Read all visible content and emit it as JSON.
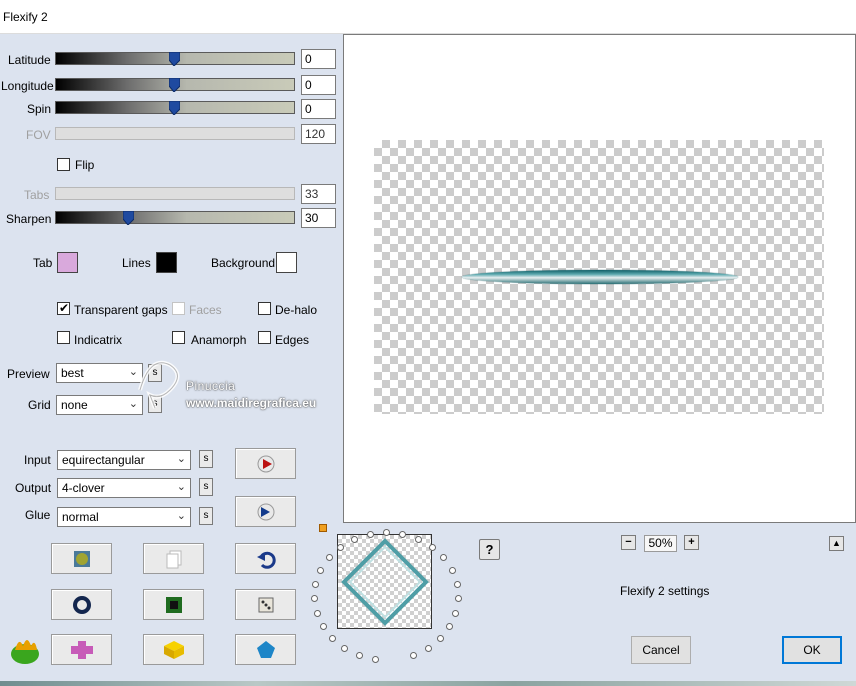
{
  "window": {
    "title": "Flexify 2"
  },
  "sliders": {
    "latitude": {
      "label": "Latitude",
      "value": "0"
    },
    "longitude": {
      "label": "Longitude",
      "value": "0"
    },
    "spin": {
      "label": "Spin",
      "value": "0"
    },
    "fov": {
      "label": "FOV",
      "value": "120"
    },
    "tabs": {
      "label": "Tabs",
      "value": "33"
    },
    "sharpen": {
      "label": "Sharpen",
      "value": "30"
    }
  },
  "flip": {
    "label": "Flip"
  },
  "colors": {
    "tab_label": "Tab",
    "tab_color": "#d9a9dc",
    "lines_label": "Lines",
    "lines_color": "#000000",
    "background_label": "Background",
    "background_color": "#ffffff"
  },
  "options": {
    "transparent_gaps": "Transparent gaps",
    "faces": "Faces",
    "de_halo": "De-halo",
    "indicatrix": "Indicatrix",
    "anamorph": "Anamorph",
    "edges": "Edges"
  },
  "preview": {
    "label": "Preview",
    "value": "best"
  },
  "grid": {
    "label": "Grid",
    "value": "none"
  },
  "projection": {
    "input_label": "Input",
    "input_value": "equirectangular",
    "output_label": "Output",
    "output_value": "4-clover",
    "glue_label": "Glue",
    "glue_value": "normal"
  },
  "s_button": "s",
  "watermark": {
    "line1": "Pinuccia",
    "line2": "www.maidiregrafica.eu"
  },
  "zoom": {
    "minus": "−",
    "value": "50%",
    "plus": "+"
  },
  "help": "?",
  "collapse": "▲",
  "settings_name": "Flexify 2 settings",
  "buttons": {
    "cancel": "Cancel",
    "ok": "OK"
  }
}
